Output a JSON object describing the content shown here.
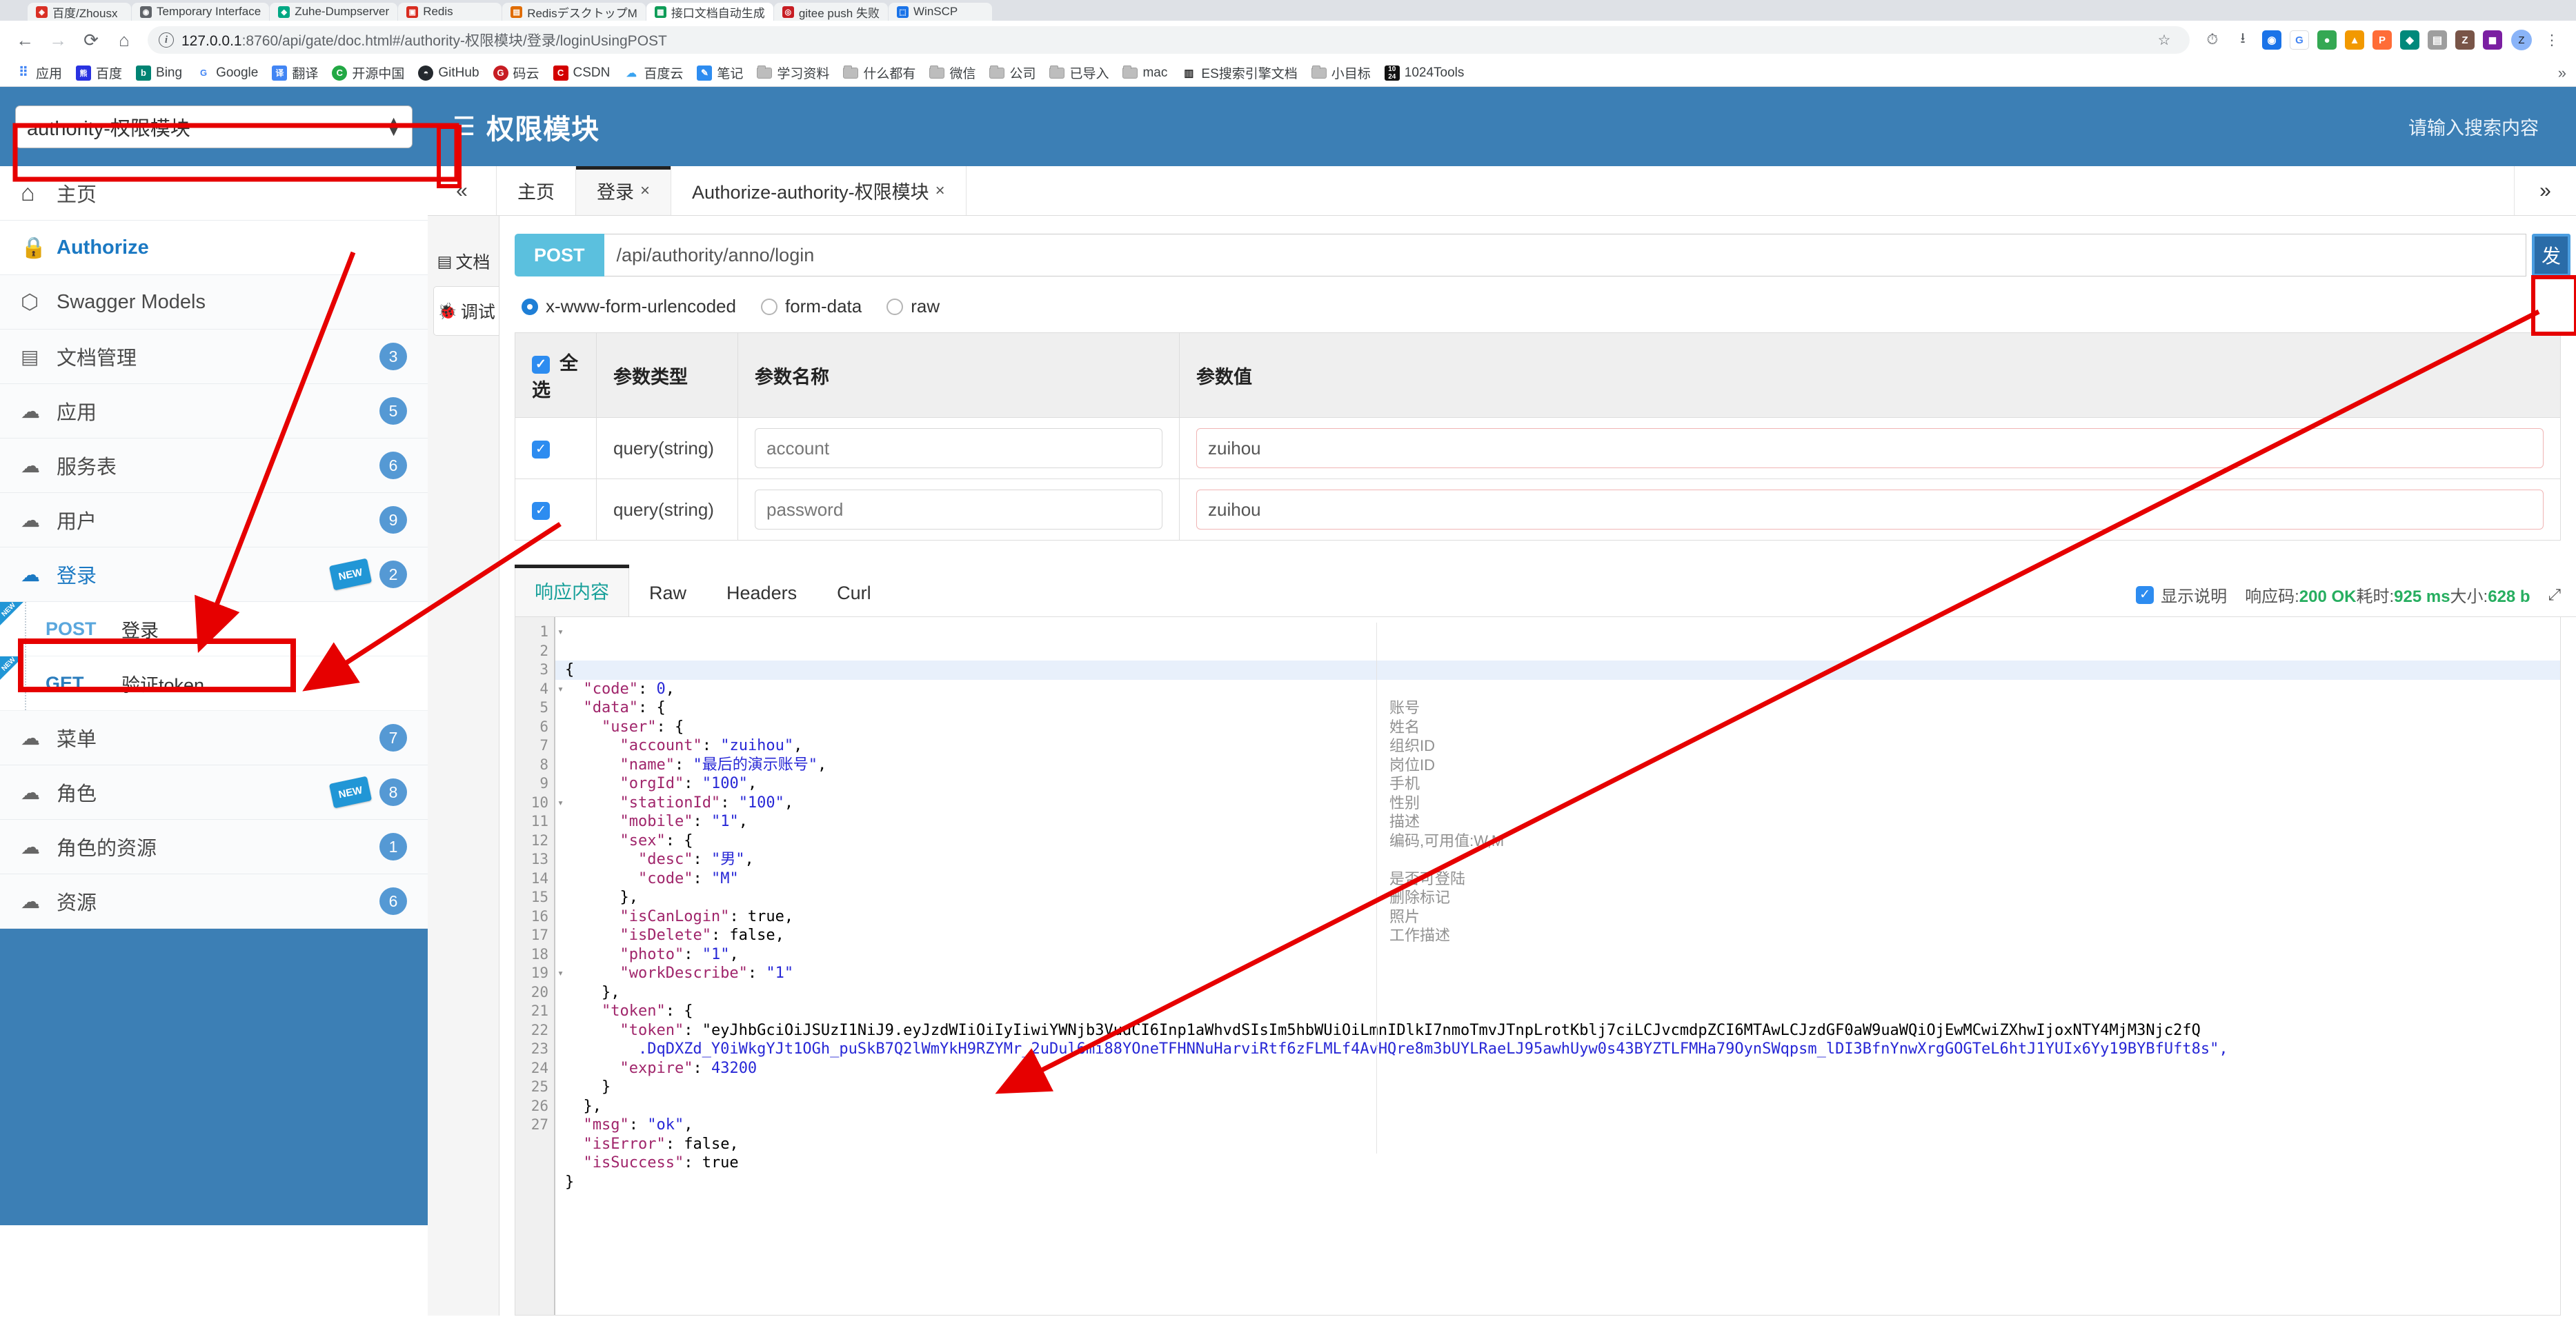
{
  "browser": {
    "tabs": [
      {
        "label": "百度/Zhousx",
        "favicon": "shield-icon",
        "color": "#d93025",
        "glyph": "◈"
      },
      {
        "label": "Temporary Interface",
        "favicon": "globe-icon",
        "color": "#5f6368",
        "glyph": "◉"
      },
      {
        "label": "Zuhe-Dumpserver",
        "favicon": "diamond-icon",
        "color": "#00a884",
        "glyph": "◆"
      },
      {
        "label": "Redis",
        "favicon": "redis-icon",
        "color": "#d82c20",
        "glyph": "▣"
      },
      {
        "label": "RedisデスクトップM",
        "favicon": "desk-icon",
        "color": "#e06c00",
        "glyph": "▤"
      },
      {
        "label": "接口文档自动生成",
        "favicon": "doc-icon",
        "color": "#0f9d58",
        "glyph": "▦"
      },
      {
        "label": "gitee push 失败",
        "favicon": "git-icon",
        "color": "#c71d23",
        "glyph": "◎"
      },
      {
        "label": "WinSCP",
        "favicon": "winscp-icon",
        "color": "#1a73e8",
        "glyph": "⬚"
      }
    ],
    "active_tab_index": 5,
    "url": {
      "host": "127.0.0.1",
      "rest": ":8760/api/gate/doc.html#/authority-权限模块/登录/loginUsingPOST",
      "full": "127.0.0.1:8760/api/gate/doc.html#/authority-权限模块/登录/loginUsingPOST"
    },
    "nav": {
      "back": "←",
      "forward": "→",
      "reload": "⟳",
      "home": "⌂",
      "bookmark_star": "☆",
      "history": "⏱",
      "downloads": "⭳",
      "profile": "Z",
      "menu": "⋮",
      "extensions_overflow": "»"
    },
    "extensions": [
      {
        "name": "ext-blue",
        "glyph": "◉",
        "color": "#1a73e8"
      },
      {
        "name": "ext-google",
        "glyph": "G",
        "color": "#ffffff"
      },
      {
        "name": "ext-green",
        "glyph": "●",
        "color": "#34a853"
      },
      {
        "name": "ext-orange",
        "glyph": "▲",
        "color": "#f29900"
      },
      {
        "name": "ext-postman",
        "glyph": "P",
        "color": "#ff6c37"
      },
      {
        "name": "ext-teal",
        "glyph": "◆",
        "color": "#00897b"
      },
      {
        "name": "ext-grey",
        "glyph": "▤",
        "color": "#9e9e9e"
      },
      {
        "name": "ext-zip",
        "glyph": "Z",
        "color": "#795548"
      },
      {
        "name": "ext-purple",
        "glyph": "◼",
        "color": "#7b1fa2"
      }
    ],
    "bookmarks": [
      {
        "label": "应用",
        "icon": "apps-grid-icon",
        "type": "grid"
      },
      {
        "label": "百度",
        "icon": "baidu-icon",
        "type": "icon",
        "color": "#2932e1",
        "glyph": "熊"
      },
      {
        "label": "Bing",
        "icon": "bing-icon",
        "type": "icon",
        "color": "#008373",
        "glyph": "b"
      },
      {
        "label": "Google",
        "icon": "google-icon",
        "type": "icon",
        "color": "#ffffff",
        "glyph": "G"
      },
      {
        "label": "翻译",
        "icon": "translate-icon",
        "type": "icon",
        "color": "#4285f4",
        "glyph": "译"
      },
      {
        "label": "开源中国",
        "icon": "oschina-icon",
        "type": "icon",
        "color": "#22a844",
        "glyph": "C"
      },
      {
        "label": "GitHub",
        "icon": "github-icon",
        "type": "icon",
        "color": "#24292e",
        "glyph": "◓"
      },
      {
        "label": "码云",
        "icon": "gitee-icon",
        "type": "icon",
        "color": "#c71d23",
        "glyph": "G"
      },
      {
        "label": "CSDN",
        "icon": "csdn-icon",
        "type": "icon",
        "color": "#d30000",
        "glyph": "C"
      },
      {
        "label": "百度云",
        "icon": "baiduyun-icon",
        "type": "icon",
        "color": "#ffffff",
        "glyph": "☁"
      },
      {
        "label": "笔记",
        "icon": "note-icon",
        "type": "icon",
        "color": "#2d8cf0",
        "glyph": "✎"
      },
      {
        "label": "学习资料",
        "icon": "folder-icon",
        "type": "folder"
      },
      {
        "label": "什么都有",
        "icon": "folder-icon",
        "type": "folder"
      },
      {
        "label": "微信",
        "icon": "folder-icon",
        "type": "folder"
      },
      {
        "label": "公司",
        "icon": "folder-icon",
        "type": "folder"
      },
      {
        "label": "已导入",
        "icon": "folder-icon",
        "type": "folder"
      },
      {
        "label": "mac",
        "icon": "folder-icon",
        "type": "folder"
      },
      {
        "label": "ES搜索引擎文档",
        "icon": "book-icon",
        "type": "icon",
        "color": "#ffffff",
        "glyph": "📖"
      },
      {
        "label": "小目标",
        "icon": "folder-icon",
        "type": "folder"
      },
      {
        "label": "1024Tools",
        "icon": "tools-icon",
        "type": "icon",
        "color": "#111111",
        "glyph": "⑩"
      }
    ]
  },
  "sidebar": {
    "module_select": {
      "value": "authority-权限模块",
      "spinner_up": "▲",
      "spinner_down": "▼"
    },
    "items": [
      {
        "label": "主页",
        "icon": "home-icon",
        "glyph": "⌂",
        "badge": "",
        "state": "plain"
      },
      {
        "label": "Authorize",
        "icon": "lock-icon",
        "glyph": "🔒",
        "badge": "",
        "state": "accent"
      },
      {
        "label": "Swagger Models",
        "icon": "models-icon",
        "glyph": "⬡",
        "badge": "",
        "state": "plain"
      },
      {
        "label": "文档管理",
        "icon": "doc-gear-icon",
        "glyph": "▤",
        "badge": "3",
        "state": "plain"
      },
      {
        "label": "应用",
        "icon": "api-cloud-icon",
        "glyph": "☁",
        "badge": "5",
        "state": "plain"
      },
      {
        "label": "服务表",
        "icon": "api-cloud-icon",
        "glyph": "☁",
        "badge": "6",
        "state": "plain"
      },
      {
        "label": "用户",
        "icon": "api-cloud-icon",
        "glyph": "☁",
        "badge": "9",
        "state": "plain"
      },
      {
        "label": "登录",
        "icon": "api-cloud-icon",
        "glyph": "☁",
        "badge": "2",
        "state": "sub-accent",
        "new": "NEW"
      },
      {
        "label": "菜单",
        "icon": "api-cloud-icon",
        "glyph": "☁",
        "badge": "7",
        "state": "plain"
      },
      {
        "label": "角色",
        "icon": "api-cloud-icon",
        "glyph": "☁",
        "badge": "8",
        "state": "plain",
        "new": "NEW"
      },
      {
        "label": "角色的资源",
        "icon": "api-cloud-icon",
        "glyph": "☁",
        "badge": "1",
        "state": "plain"
      },
      {
        "label": "资源",
        "icon": "api-cloud-icon",
        "glyph": "☁",
        "badge": "6",
        "state": "plain"
      }
    ],
    "endpoints": [
      {
        "method": "POST",
        "name": "登录",
        "new": "NEW",
        "selected": true
      },
      {
        "method": "GET",
        "name": "验证token",
        "new": "NEW",
        "selected": false
      }
    ]
  },
  "topbar": {
    "menu_icon": "hamburger-icon",
    "title": "权限模块",
    "search_placeholder": "请输入搜索内容"
  },
  "page_tabs": {
    "collapse_icon": "«",
    "expand_icon": "»",
    "items": [
      {
        "label": "主页",
        "closable": false,
        "active": false
      },
      {
        "label": "登录",
        "closable": true,
        "active": true
      },
      {
        "label": "Authorize-authority-权限模块",
        "closable": true,
        "active": false
      }
    ],
    "close_glyph": "×"
  },
  "vertical_tabs": [
    {
      "label": "文档",
      "icon": "document-icon",
      "glyph": "📄",
      "active": false
    },
    {
      "label": "调试",
      "icon": "bug-icon",
      "glyph": "🐞",
      "active": true
    }
  ],
  "request": {
    "method": "POST",
    "url": "/api/authority/anno/login",
    "send_label": "发",
    "body_types": [
      {
        "label": "x-www-form-urlencoded",
        "selected": true
      },
      {
        "label": "form-data",
        "selected": false
      },
      {
        "label": "raw",
        "selected": false
      }
    ],
    "table": {
      "headers": {
        "select_all": "全选",
        "param_type": "参数类型",
        "param_name": "参数名称",
        "param_value": "参数值"
      },
      "rows": [
        {
          "checked": true,
          "type": "query(string)",
          "name": "account",
          "value": "zuihou"
        },
        {
          "checked": true,
          "type": "query(string)",
          "name": "password",
          "value": "zuihou"
        }
      ]
    }
  },
  "response": {
    "tabs": [
      {
        "label": "响应内容",
        "active": true
      },
      {
        "label": "Raw",
        "active": false
      },
      {
        "label": "Headers",
        "active": false
      },
      {
        "label": "Curl",
        "active": false
      }
    ],
    "show_desc_label": "显示说明",
    "show_desc_checked": true,
    "status_prefix": "响应码:",
    "status_code": "200 OK",
    "time_prefix": "耗时:",
    "time_value": "925 ms",
    "size_prefix": "大小:",
    "size_value": "628 b",
    "expand_icon": "⤢",
    "code_lines": [
      {
        "n": "1",
        "fold": true,
        "text": "{"
      },
      {
        "n": "2",
        "fold": false,
        "text": "  \"code\": 0,"
      },
      {
        "n": "3",
        "fold": true,
        "text": "  \"data\": {"
      },
      {
        "n": "4",
        "fold": true,
        "text": "    \"user\": {"
      },
      {
        "n": "5",
        "fold": false,
        "text": "      \"account\": \"zuihou\","
      },
      {
        "n": "6",
        "fold": false,
        "text": "      \"name\": \"最后的演示账号\","
      },
      {
        "n": "7",
        "fold": false,
        "text": "      \"orgId\": \"100\","
      },
      {
        "n": "8",
        "fold": false,
        "text": "      \"stationId\": \"100\","
      },
      {
        "n": "9",
        "fold": false,
        "text": "      \"mobile\": \"1\","
      },
      {
        "n": "10",
        "fold": true,
        "text": "      \"sex\": {"
      },
      {
        "n": "11",
        "fold": false,
        "text": "        \"desc\": \"男\","
      },
      {
        "n": "12",
        "fold": false,
        "text": "        \"code\": \"M\""
      },
      {
        "n": "13",
        "fold": false,
        "text": "      },"
      },
      {
        "n": "14",
        "fold": false,
        "text": "      \"isCanLogin\": true,"
      },
      {
        "n": "15",
        "fold": false,
        "text": "      \"isDelete\": false,"
      },
      {
        "n": "16",
        "fold": false,
        "text": "      \"photo\": \"1\","
      },
      {
        "n": "17",
        "fold": false,
        "text": "      \"workDescribe\": \"1\""
      },
      {
        "n": "18",
        "fold": false,
        "text": "    },"
      },
      {
        "n": "19",
        "fold": true,
        "text": "    \"token\": {"
      },
      {
        "n": "20",
        "fold": false,
        "text": "      \"token\": \"eyJhbGciOiJSUzI1NiJ9.eyJzdWIiOiIyIiwiYWNjb3VudCI6Inp1aWhvdSIsIm5hbWUiOiLmnIDlkI7nmoTmvJTnpLrotKblj7ciLCJvcmdpZCI6MTAwLCJzdGF0aW9uaWQiOjEwMCwiZXhwIjoxNTY4MjM3Njc2fQ"
      },
      {
        "n": "",
        "fold": false,
        "text": "        .DqDXZd_Y0iWkgYJt1OGh_puSkB7Q2lWmYkH9RZYMr_2uDul6mi88YOneTFHNNuHarviRtf6zFLMLf4AvHQre8m3bUYLRaeLJ95awhUyw0s43BYZTLFMHa79OynSWqpsm_lDI3BfnYnwXrgGOGTeL6htJ1YUIx6Yy19BYBfUft8s\","
      },
      {
        "n": "21",
        "fold": false,
        "text": "      \"expire\": 43200"
      },
      {
        "n": "22",
        "fold": false,
        "text": "    }"
      },
      {
        "n": "23",
        "fold": false,
        "text": "  },"
      },
      {
        "n": "24",
        "fold": false,
        "text": "  \"msg\": \"ok\","
      },
      {
        "n": "25",
        "fold": false,
        "text": "  \"isError\": false,"
      },
      {
        "n": "26",
        "fold": false,
        "text": "  \"isSuccess\": true"
      },
      {
        "n": "27",
        "fold": false,
        "text": "}"
      }
    ],
    "annotations": [
      "",
      "",
      "",
      "",
      "账号",
      "姓名",
      "组织ID",
      "岗位ID",
      "手机",
      "性别",
      "描述",
      "编码,可用值:W,M",
      "",
      "是否可登陆",
      "删除标记",
      "照片",
      "工作描述",
      "",
      "",
      "",
      "",
      "",
      "",
      "",
      "",
      "",
      "",
      ""
    ]
  },
  "colors": {
    "brand_blue": "#3c7fb5",
    "accent_blue": "#1b79c3",
    "method_post": "#5bc0de",
    "send_button": "#2a6ca8",
    "annotation_red": "#e60000",
    "status_green": "#27ae60",
    "badge_blue": "#5599d4"
  }
}
